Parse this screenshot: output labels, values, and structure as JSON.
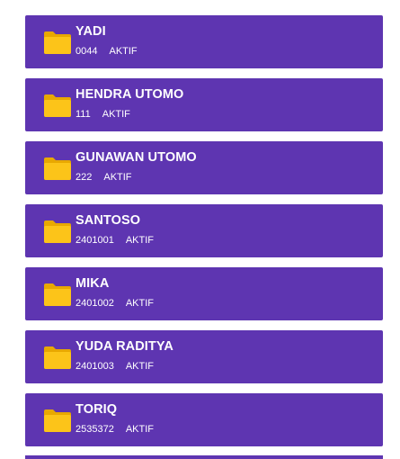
{
  "colors": {
    "card_bg": "#5e35b1",
    "text": "#ffffff",
    "folder_icon": "#fcc419"
  },
  "items": [
    {
      "name": "YADI",
      "code": "0044",
      "status": "AKTIF",
      "icon": "folder-icon"
    },
    {
      "name": "HENDRA UTOMO",
      "code": "111",
      "status": "AKTIF",
      "icon": "folder-icon"
    },
    {
      "name": "GUNAWAN UTOMO",
      "code": "222",
      "status": "AKTIF",
      "icon": "folder-icon"
    },
    {
      "name": "SANTOSO",
      "code": "2401001",
      "status": "AKTIF",
      "icon": "folder-icon"
    },
    {
      "name": "MIKA",
      "code": "2401002",
      "status": "AKTIF",
      "icon": "folder-icon"
    },
    {
      "name": "YUDA RADITYA",
      "code": "2401003",
      "status": "AKTIF",
      "icon": "folder-icon"
    },
    {
      "name": "TORIQ",
      "code": "2535372",
      "status": "AKTIF",
      "icon": "folder-icon"
    }
  ]
}
